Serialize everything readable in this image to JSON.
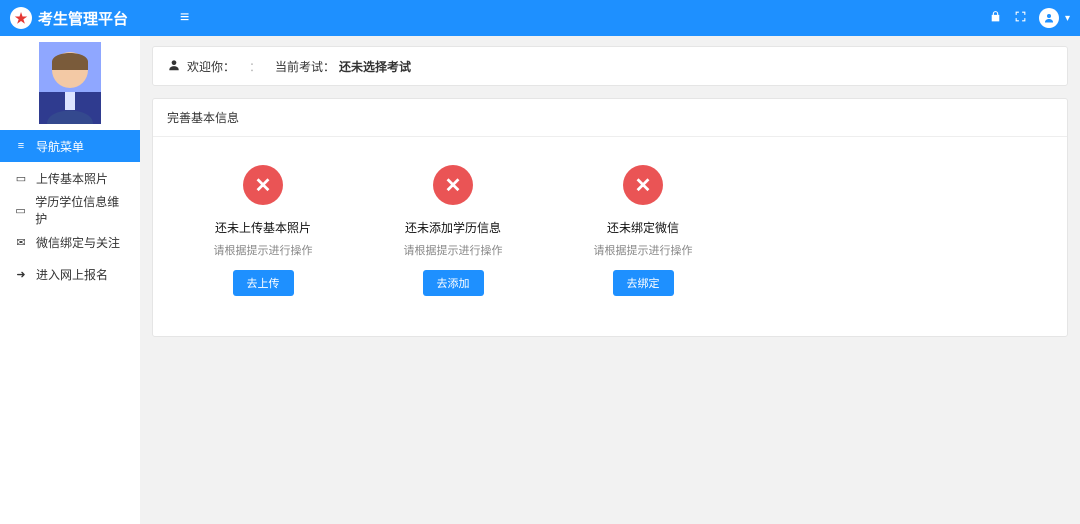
{
  "topbar": {
    "title": "考生管理平台"
  },
  "sidebar": {
    "menu_header": "导航菜单",
    "items": [
      {
        "icon": "▭",
        "label": "上传基本照片"
      },
      {
        "icon": "▭",
        "label": "学历学位信息维护"
      },
      {
        "icon": "✉",
        "label": "微信绑定与关注"
      },
      {
        "icon": "➜",
        "label": "进入网上报名"
      }
    ]
  },
  "welcome": {
    "greet": "欢迎你：",
    "sep": "：",
    "curexam_label": "当前考试：",
    "curexam_value": "还未选择考试"
  },
  "panel": {
    "title": "完善基本信息",
    "tasks": [
      {
        "title": "还未上传基本照片",
        "hint": "请根据提示进行操作",
        "btn": "去上传"
      },
      {
        "title": "还未添加学历信息",
        "hint": "请根据提示进行操作",
        "btn": "去添加"
      },
      {
        "title": "还未绑定微信",
        "hint": "请根据提示进行操作",
        "btn": "去绑定"
      }
    ]
  }
}
